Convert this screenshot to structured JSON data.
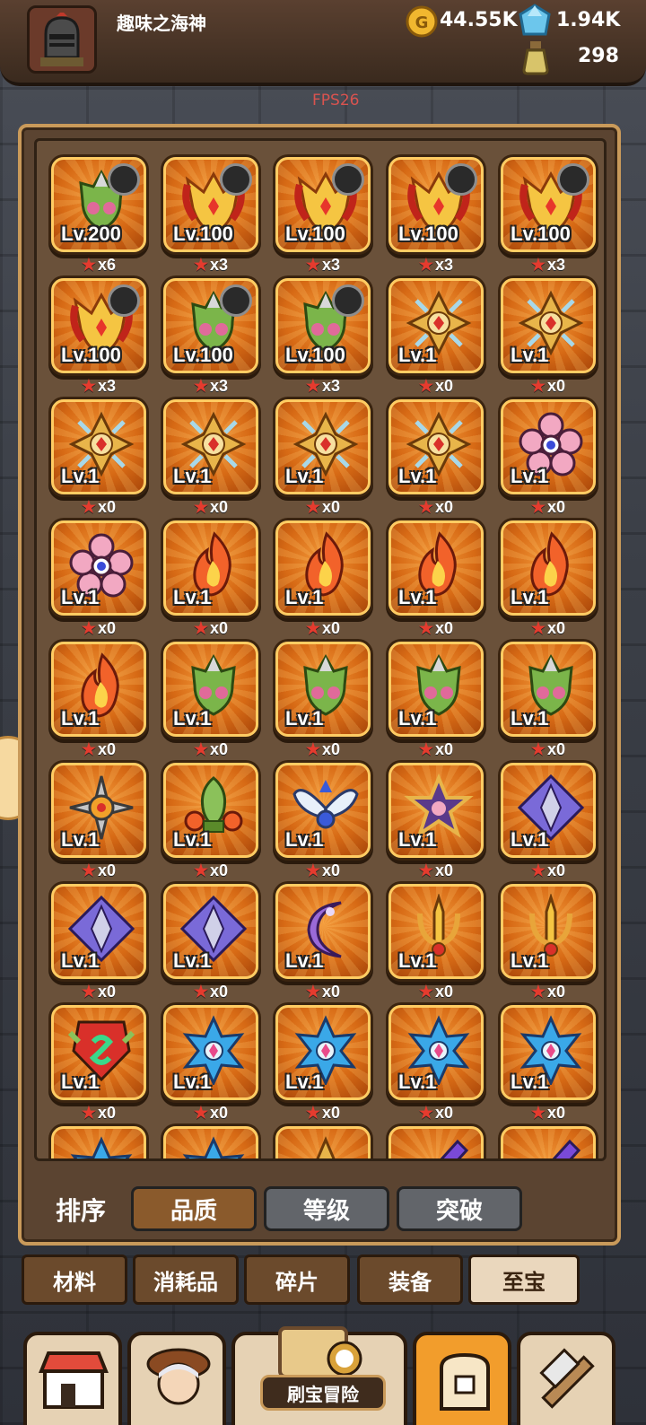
{
  "player": {
    "name": "趣味之海神"
  },
  "resources": {
    "gold": "44.55K",
    "gems": "1.94K",
    "potion": "298"
  },
  "fps": "FPS26",
  "items": [
    {
      "level": "Lv.200",
      "count": "x6",
      "art": "leaf",
      "badge": true
    },
    {
      "level": "Lv.100",
      "count": "x3",
      "art": "flame-crown",
      "badge": true
    },
    {
      "level": "Lv.100",
      "count": "x3",
      "art": "flame-crown",
      "badge": true
    },
    {
      "level": "Lv.100",
      "count": "x3",
      "art": "flame-crown",
      "badge": true
    },
    {
      "level": "Lv.100",
      "count": "x3",
      "art": "flame-crown",
      "badge": true
    },
    {
      "level": "Lv.100",
      "count": "x3",
      "art": "flame-crown",
      "badge": true
    },
    {
      "level": "Lv.100",
      "count": "x3",
      "art": "leaf",
      "badge": true
    },
    {
      "level": "Lv.100",
      "count": "x3",
      "art": "leaf",
      "badge": true
    },
    {
      "level": "Lv.1",
      "count": "x0",
      "art": "cross",
      "badge": false
    },
    {
      "level": "Lv.1",
      "count": "x0",
      "art": "cross",
      "badge": false
    },
    {
      "level": "Lv.1",
      "count": "x0",
      "art": "cross",
      "badge": false
    },
    {
      "level": "Lv.1",
      "count": "x0",
      "art": "cross",
      "badge": false
    },
    {
      "level": "Lv.1",
      "count": "x0",
      "art": "cross",
      "badge": false
    },
    {
      "level": "Lv.1",
      "count": "x0",
      "art": "cross",
      "badge": false
    },
    {
      "level": "Lv.1",
      "count": "x0",
      "art": "flower",
      "badge": false
    },
    {
      "level": "Lv.1",
      "count": "x0",
      "art": "flower",
      "badge": false
    },
    {
      "level": "Lv.1",
      "count": "x0",
      "art": "fire",
      "badge": false
    },
    {
      "level": "Lv.1",
      "count": "x0",
      "art": "fire",
      "badge": false
    },
    {
      "level": "Lv.1",
      "count": "x0",
      "art": "fire",
      "badge": false
    },
    {
      "level": "Lv.1",
      "count": "x0",
      "art": "fire",
      "badge": false
    },
    {
      "level": "Lv.1",
      "count": "x0",
      "art": "fire",
      "badge": false
    },
    {
      "level": "Lv.1",
      "count": "x0",
      "art": "leaf",
      "badge": false
    },
    {
      "level": "Lv.1",
      "count": "x0",
      "art": "leaf",
      "badge": false
    },
    {
      "level": "Lv.1",
      "count": "x0",
      "art": "leaf",
      "badge": false
    },
    {
      "level": "Lv.1",
      "count": "x0",
      "art": "leaf",
      "badge": false
    },
    {
      "level": "Lv.1",
      "count": "x0",
      "art": "shuriken",
      "badge": false
    },
    {
      "level": "Lv.1",
      "count": "x0",
      "art": "plant",
      "badge": false
    },
    {
      "level": "Lv.1",
      "count": "x0",
      "art": "wings",
      "badge": false
    },
    {
      "level": "Lv.1",
      "count": "x0",
      "art": "star",
      "badge": false
    },
    {
      "level": "Lv.1",
      "count": "x0",
      "art": "diamond",
      "badge": false
    },
    {
      "level": "Lv.1",
      "count": "x0",
      "art": "diamond",
      "badge": false
    },
    {
      "level": "Lv.1",
      "count": "x0",
      "art": "diamond",
      "badge": false
    },
    {
      "level": "Lv.1",
      "count": "x0",
      "art": "moon",
      "badge": false
    },
    {
      "level": "Lv.1",
      "count": "x0",
      "art": "trident",
      "badge": false
    },
    {
      "level": "Lv.1",
      "count": "x0",
      "art": "trident",
      "badge": false
    },
    {
      "level": "Lv.1",
      "count": "x0",
      "art": "emblem",
      "badge": false
    },
    {
      "level": "Lv.1",
      "count": "x0",
      "art": "hexstar",
      "badge": false
    },
    {
      "level": "Lv.1",
      "count": "x0",
      "art": "hexstar",
      "badge": false
    },
    {
      "level": "Lv.1",
      "count": "x0",
      "art": "hexstar",
      "badge": false
    },
    {
      "level": "Lv.1",
      "count": "x0",
      "art": "hexstar",
      "badge": false
    }
  ],
  "partial_row": [
    "hexstar",
    "hexstar",
    "spike",
    "blade",
    "blade"
  ],
  "sort": {
    "label": "排序",
    "options": [
      "品质",
      "等级",
      "突破"
    ],
    "active": 0
  },
  "categories": {
    "items": [
      "材料",
      "消耗品",
      "碎片",
      "装备",
      "至宝"
    ],
    "active": 4
  },
  "bottom_nav": {
    "adventure_label": "刷宝冒险"
  },
  "colors": {
    "slot_border": "#ffcc63",
    "slot_fill": "#d76a15",
    "star": "#e53b2e",
    "active_sort": "#8a5a2c",
    "active_tab": "#ead7bd",
    "nav_selected": "#f29d2c"
  }
}
